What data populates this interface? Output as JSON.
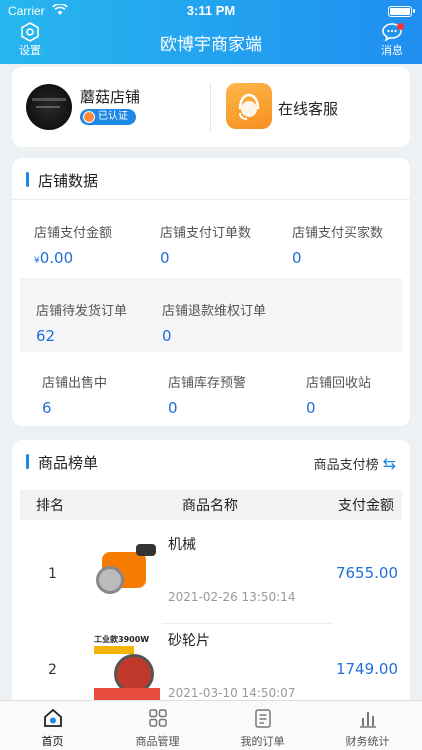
{
  "status": {
    "carrier": "Carrier",
    "time": "3:11 PM"
  },
  "nav": {
    "title": "欧博宇商家端",
    "settings_label": "设置",
    "messages_label": "消息"
  },
  "store": {
    "name": "蘑菇店铺",
    "verified": "已认证",
    "customer_service": "在线客服"
  },
  "shop_data": {
    "title": "店铺数据",
    "metrics": [
      {
        "label": "店铺支付金额",
        "currency": "¥",
        "value": "0.00"
      },
      {
        "label": "店铺支付订单数",
        "value": "0"
      },
      {
        "label": "店铺支付买家数",
        "value": "0"
      },
      {
        "label": "店铺待发货订单",
        "value": "62"
      },
      {
        "label": "店铺退款维权订单",
        "value": "0"
      },
      {
        "label": "店铺出售中",
        "value": "6"
      },
      {
        "label": "店铺库存预警",
        "value": "0"
      },
      {
        "label": "店铺回收站",
        "value": "0"
      }
    ]
  },
  "ranking": {
    "title": "商品榜单",
    "switch_label": "商品支付榜",
    "headers": {
      "rank": "排名",
      "name": "商品名称",
      "amount": "支付金额"
    },
    "rows": [
      {
        "rank": "1",
        "name": "机械",
        "time": "2021-02-26 13:50:14",
        "amount": "7655.00"
      },
      {
        "rank": "2",
        "name": "砂轮片",
        "time": "2021-03-10 14:50:07",
        "amount": "1749.00",
        "image_tag": "工业款3900W"
      }
    ]
  },
  "tabs": [
    {
      "label": "首页",
      "icon": "home-icon"
    },
    {
      "label": "商品管理",
      "icon": "grid-icon"
    },
    {
      "label": "我的订单",
      "icon": "clipboard-icon"
    },
    {
      "label": "财务统计",
      "icon": "bar-chart-icon"
    }
  ],
  "colors": {
    "accent": "#1e88e5",
    "header_start": "#27b7ee",
    "header_end": "#1f8ff0"
  }
}
